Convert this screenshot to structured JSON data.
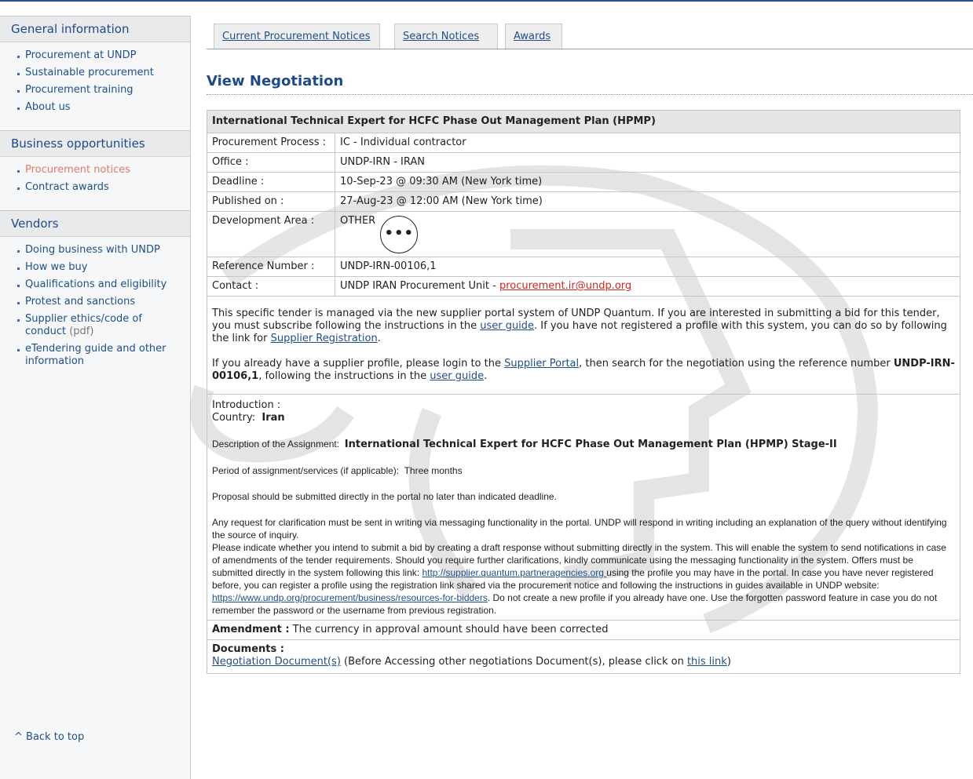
{
  "sidebar": {
    "general": {
      "heading": "General information",
      "items": [
        "Procurement at UNDP",
        "Sustainable procurement",
        "Procurement training",
        "About us"
      ]
    },
    "business": {
      "heading": "Business opportunities",
      "items": [
        "Procurement notices",
        "Contract awards"
      ]
    },
    "vendors": {
      "heading": "Vendors",
      "items": [
        "Doing business with UNDP",
        "How we buy",
        "Qualifications and eligibility",
        "Protest and sanctions",
        "Supplier ethics/code of conduct",
        "eTendering guide and other information"
      ],
      "pdf_note": "(pdf)"
    },
    "back_to_top": "^ Back to top"
  },
  "tabs": [
    "Current Procurement Notices",
    "Search Notices",
    "Awards"
  ],
  "page_title": "View Negotiation",
  "notice": {
    "header": "International Technical Expert for HCFC Phase Out Management Plan (HPMP)",
    "rows": {
      "process": {
        "label": "Procurement Process :",
        "value": "IC - Individual contractor"
      },
      "office": {
        "label": "Office :",
        "value": "UNDP-IRN - IRAN"
      },
      "deadline": {
        "label": "Deadline :",
        "value": "10-Sep-23 @ 09:30 AM (New York time)"
      },
      "published": {
        "label": "Published on :",
        "value": "27-Aug-23 @ 12:00 AM (New York time)"
      },
      "area": {
        "label": "Development Area :",
        "value": "OTHER",
        "more": "•••"
      },
      "reference": {
        "label": "Reference Number :",
        "value": "UNDP-IRN-00106,1"
      },
      "contact": {
        "label": "Contact :",
        "value": "UNDP IRAN Procurement Unit - ",
        "email": "procurement.ir@undp.org"
      }
    },
    "portal": {
      "p1_a": "This specific tender is managed via the new supplier portal system of UNDP Quantum. If you are interested in submitting a bid for this tender, you must subscribe following the instructions in the ",
      "user_guide": "user guide",
      "p1_b": ". If you have not registered a profile with this system, you can do so by following the link for ",
      "supplier_registration": "Supplier Registration",
      "p1_c": ".",
      "p2_a": "If you already have a supplier profile, please login to the ",
      "supplier_portal": "Supplier Portal",
      "p2_b": ", then search for the negotiation using the reference number ",
      "ref_bold": "UNDP-IRN-00106,1",
      "p2_c": ", following the instructions in the ",
      "p2_d": "."
    },
    "intro": {
      "intro_label": "Introduction :",
      "country_label": "Country:",
      "country_value": "Iran",
      "desc_label": "Description of the Assignment:",
      "desc_value": "International Technical Expert for HCFC Phase Out Management Plan (HPMP) Stage-II",
      "period_label": "Period of assignment/services (if applicable):",
      "period_value": "Three months",
      "proposal": "Proposal should be submitted directly in the portal no later than indicated deadline.",
      "clarification": "Any request for clarification must be sent in writing via messaging functionality in the portal. UNDP will respond in writing including an explanation of the query without identifying the source of inquiry.",
      "indicate_a": "Please indicate whether you intend to submit a bid by creating a draft response without submitting directly in the system. This will enable the system to send notifications in case of amendments of the tender requirements. Should you require further clarifications, kindly communicate using the messaging functionality in the system. Offers must be submitted directly in the system following this link: ",
      "link1": "http://supplier.quantum.partneragencies.org ",
      "indicate_b": " using the profile you may have in the portal. In case you have never registered before, you can register a profile using the registration link shared via the procurement notice and following the instructions in guides available in UNDP website: ",
      "link2": "https://www.undp.org/procurement/business/resources-for-bidders",
      "indicate_c": ".  Do not create a new profile if you already have one. Use the forgotten password feature in case you do not remember the password or the username from previous registration."
    },
    "amendment": {
      "label": "Amendment :",
      "value": " The currency in approval amount should have been corrected"
    },
    "documents": {
      "label": "Documents :",
      "link": "Negotiation Document(s)",
      "text_a": " (Before Accessing other negotiations Document(s), please click on ",
      "this_link": "this link",
      "text_b": ")"
    }
  },
  "colors": {
    "accent": "#1f4a8a",
    "active_link": "#e07a6c",
    "email": "#c62828"
  }
}
